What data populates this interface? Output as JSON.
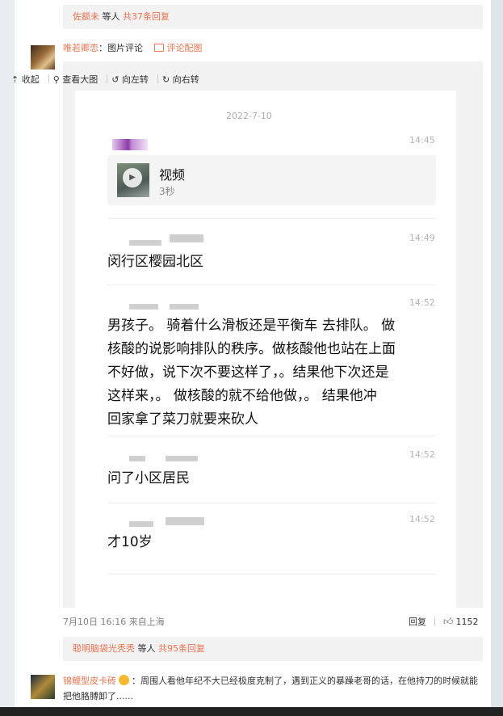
{
  "thread1": {
    "user": "佐额未",
    "mid": " 等人 ",
    "count": "共37条回复"
  },
  "comment1": {
    "user": "唯若卿恋",
    "sep": "：",
    "kind": "图片评论",
    "pic_label": "评论配图"
  },
  "toolbar": {
    "collapse": "收起",
    "view_big": "查看大图",
    "rotate_left": "向左转",
    "rotate_right": "向右转"
  },
  "chat": {
    "date": "2022-7-10",
    "messages": [
      {
        "time": "14:45",
        "video_title": "视频",
        "video_duration": "3秒"
      },
      {
        "time": "14:49",
        "text": "闵行区樱园北区"
      },
      {
        "time": "14:52",
        "lines": [
          "男孩子。 骑着什么滑板还是平衡车 去排队。 做",
          "核酸的说影响排队的秩序。做核酸他也站在上面",
          "不好做，说下次不要这样了，。结果他下次还是",
          "这样来，。 做核酸的就不给他做，。 结果他冲",
          "回家拿了菜刀就要来砍人"
        ]
      },
      {
        "time": "14:52",
        "text": "问了小区居民"
      },
      {
        "time": "14:52",
        "text": "才10岁"
      }
    ]
  },
  "footer": {
    "meta": "7月10日 16:16 来自上海",
    "reply": "回复",
    "likes": "1152"
  },
  "thread2": {
    "user": "聪明脑袋光秃秃",
    "mid": " 等人 ",
    "count": "共95条回复"
  },
  "comment2": {
    "user": "锦鲤型皮卡砖",
    "text": "：周围人看他年纪不大已经极度克制了，遇到正义的暴躁老哥的话，在他持刀的时候就能把他胳膊卸了......"
  },
  "colors": {
    "accent": "#eb7350",
    "link_gray": "#808080"
  },
  "icons": [
    "upload-arrow-icon",
    "search-icon",
    "rotate-left-icon",
    "rotate-right-icon",
    "image-icon",
    "play-icon",
    "thumbs-up-icon"
  ]
}
